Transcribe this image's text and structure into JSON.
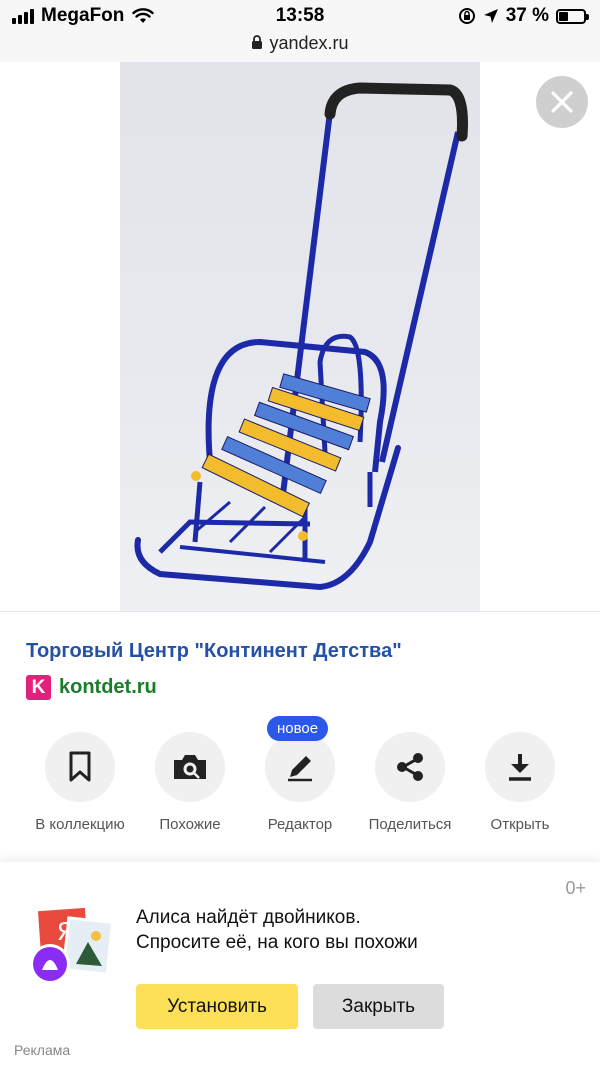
{
  "status_bar": {
    "carrier": "MegaFon",
    "time": "13:58",
    "url": "yandex.ru",
    "battery": "37 %",
    "battery_level": 0.37
  },
  "result": {
    "title": "Торговый Центр \"Континент Детства\"",
    "favicon_letter": "K",
    "domain": "kontdet.ru"
  },
  "actions": [
    {
      "label": "В коллекцию",
      "icon": "bookmark-icon"
    },
    {
      "label": "Похожие",
      "icon": "camera-icon"
    },
    {
      "label": "Редактор",
      "icon": "pencil-icon"
    },
    {
      "label": "Поделиться",
      "icon": "share-icon"
    },
    {
      "label": "Открыть",
      "icon": "download-icon"
    }
  ],
  "new_badge": "новое",
  "ad": {
    "age_rating": "0+",
    "line1": "Алиса найдёт двойников.",
    "line2": "Спросите её, на кого вы похожи",
    "install_label": "Установить",
    "close_label": "Закрыть",
    "ad_label": "Реклама",
    "icon_letter": "Я"
  },
  "colors": {
    "title": "#2451a8",
    "domain": "#1a7d2a",
    "badge": "#2b58e8",
    "install": "#fde057",
    "favicon": "#e2217d"
  }
}
